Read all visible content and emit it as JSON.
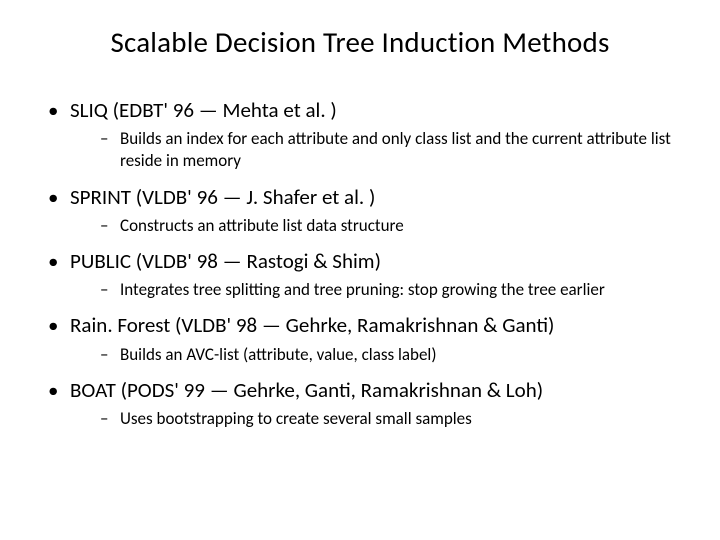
{
  "title": "Scalable Decision Tree Induction Methods",
  "items": [
    {
      "label": "SLIQ (EDBT' 96 — Mehta et al. )",
      "sub": [
        "Builds an index for each attribute and only class list and the current attribute list reside in memory"
      ]
    },
    {
      "label": "SPRINT (VLDB' 96 — J. Shafer et al. )",
      "sub": [
        "Constructs an attribute list data structure"
      ]
    },
    {
      "label": "PUBLIC (VLDB' 98 — Rastogi & Shim)",
      "sub": [
        "Integrates tree splitting and tree pruning: stop growing the tree earlier"
      ]
    },
    {
      "label": "Rain. Forest (VLDB' 98 — Gehrke, Ramakrishnan & Ganti)",
      "sub": [
        "Builds an AVC-list (attribute, value, class label)"
      ]
    },
    {
      "label": "BOAT (PODS' 99 — Gehrke, Ganti, Ramakrishnan & Loh)",
      "sub": [
        "Uses bootstrapping to create several small samples"
      ]
    }
  ]
}
